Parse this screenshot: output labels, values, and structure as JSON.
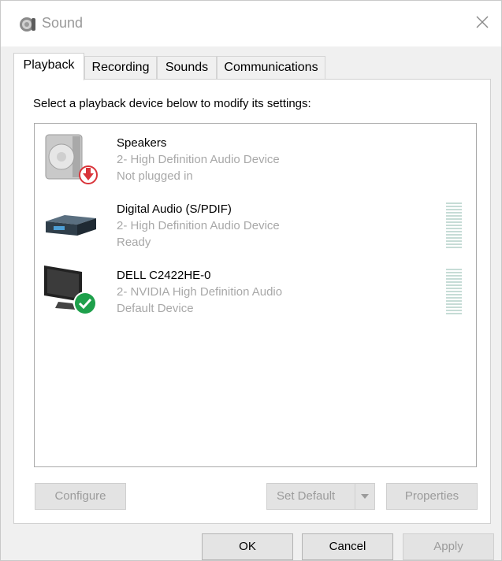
{
  "window": {
    "title": "Sound",
    "title_icon": "speaker-icon",
    "close_icon": "close-icon"
  },
  "tabs": [
    {
      "label": "Playback",
      "active": true
    },
    {
      "label": "Recording",
      "active": false
    },
    {
      "label": "Sounds",
      "active": false
    },
    {
      "label": "Communications",
      "active": false
    }
  ],
  "panel": {
    "instructions": "Select a playback device below to modify its settings:"
  },
  "devices": [
    {
      "name": "Speakers",
      "line1": "2- High Definition Audio Device",
      "line2": "Not plugged in",
      "icon": "speaker-device-icon",
      "badge": "unplugged-arrow-icon",
      "meter": false
    },
    {
      "name": "Digital Audio (S/PDIF)",
      "line1": "2- High Definition Audio Device",
      "line2": "Ready",
      "icon": "digital-audio-device-icon",
      "badge": "",
      "meter": true
    },
    {
      "name": "DELL C2422HE-0",
      "line1": "2- NVIDIA High Definition Audio",
      "line2": "Default Device",
      "icon": "monitor-device-icon",
      "badge": "default-check-icon",
      "meter": true
    }
  ],
  "buttons": {
    "configure": "Configure",
    "set_default": "Set Default",
    "properties": "Properties",
    "ok": "OK",
    "cancel": "Cancel",
    "apply": "Apply"
  },
  "colors": {
    "unplugged_badge": "#d9343a",
    "default_badge": "#1ea04b",
    "meter": "#c6dcd6"
  }
}
